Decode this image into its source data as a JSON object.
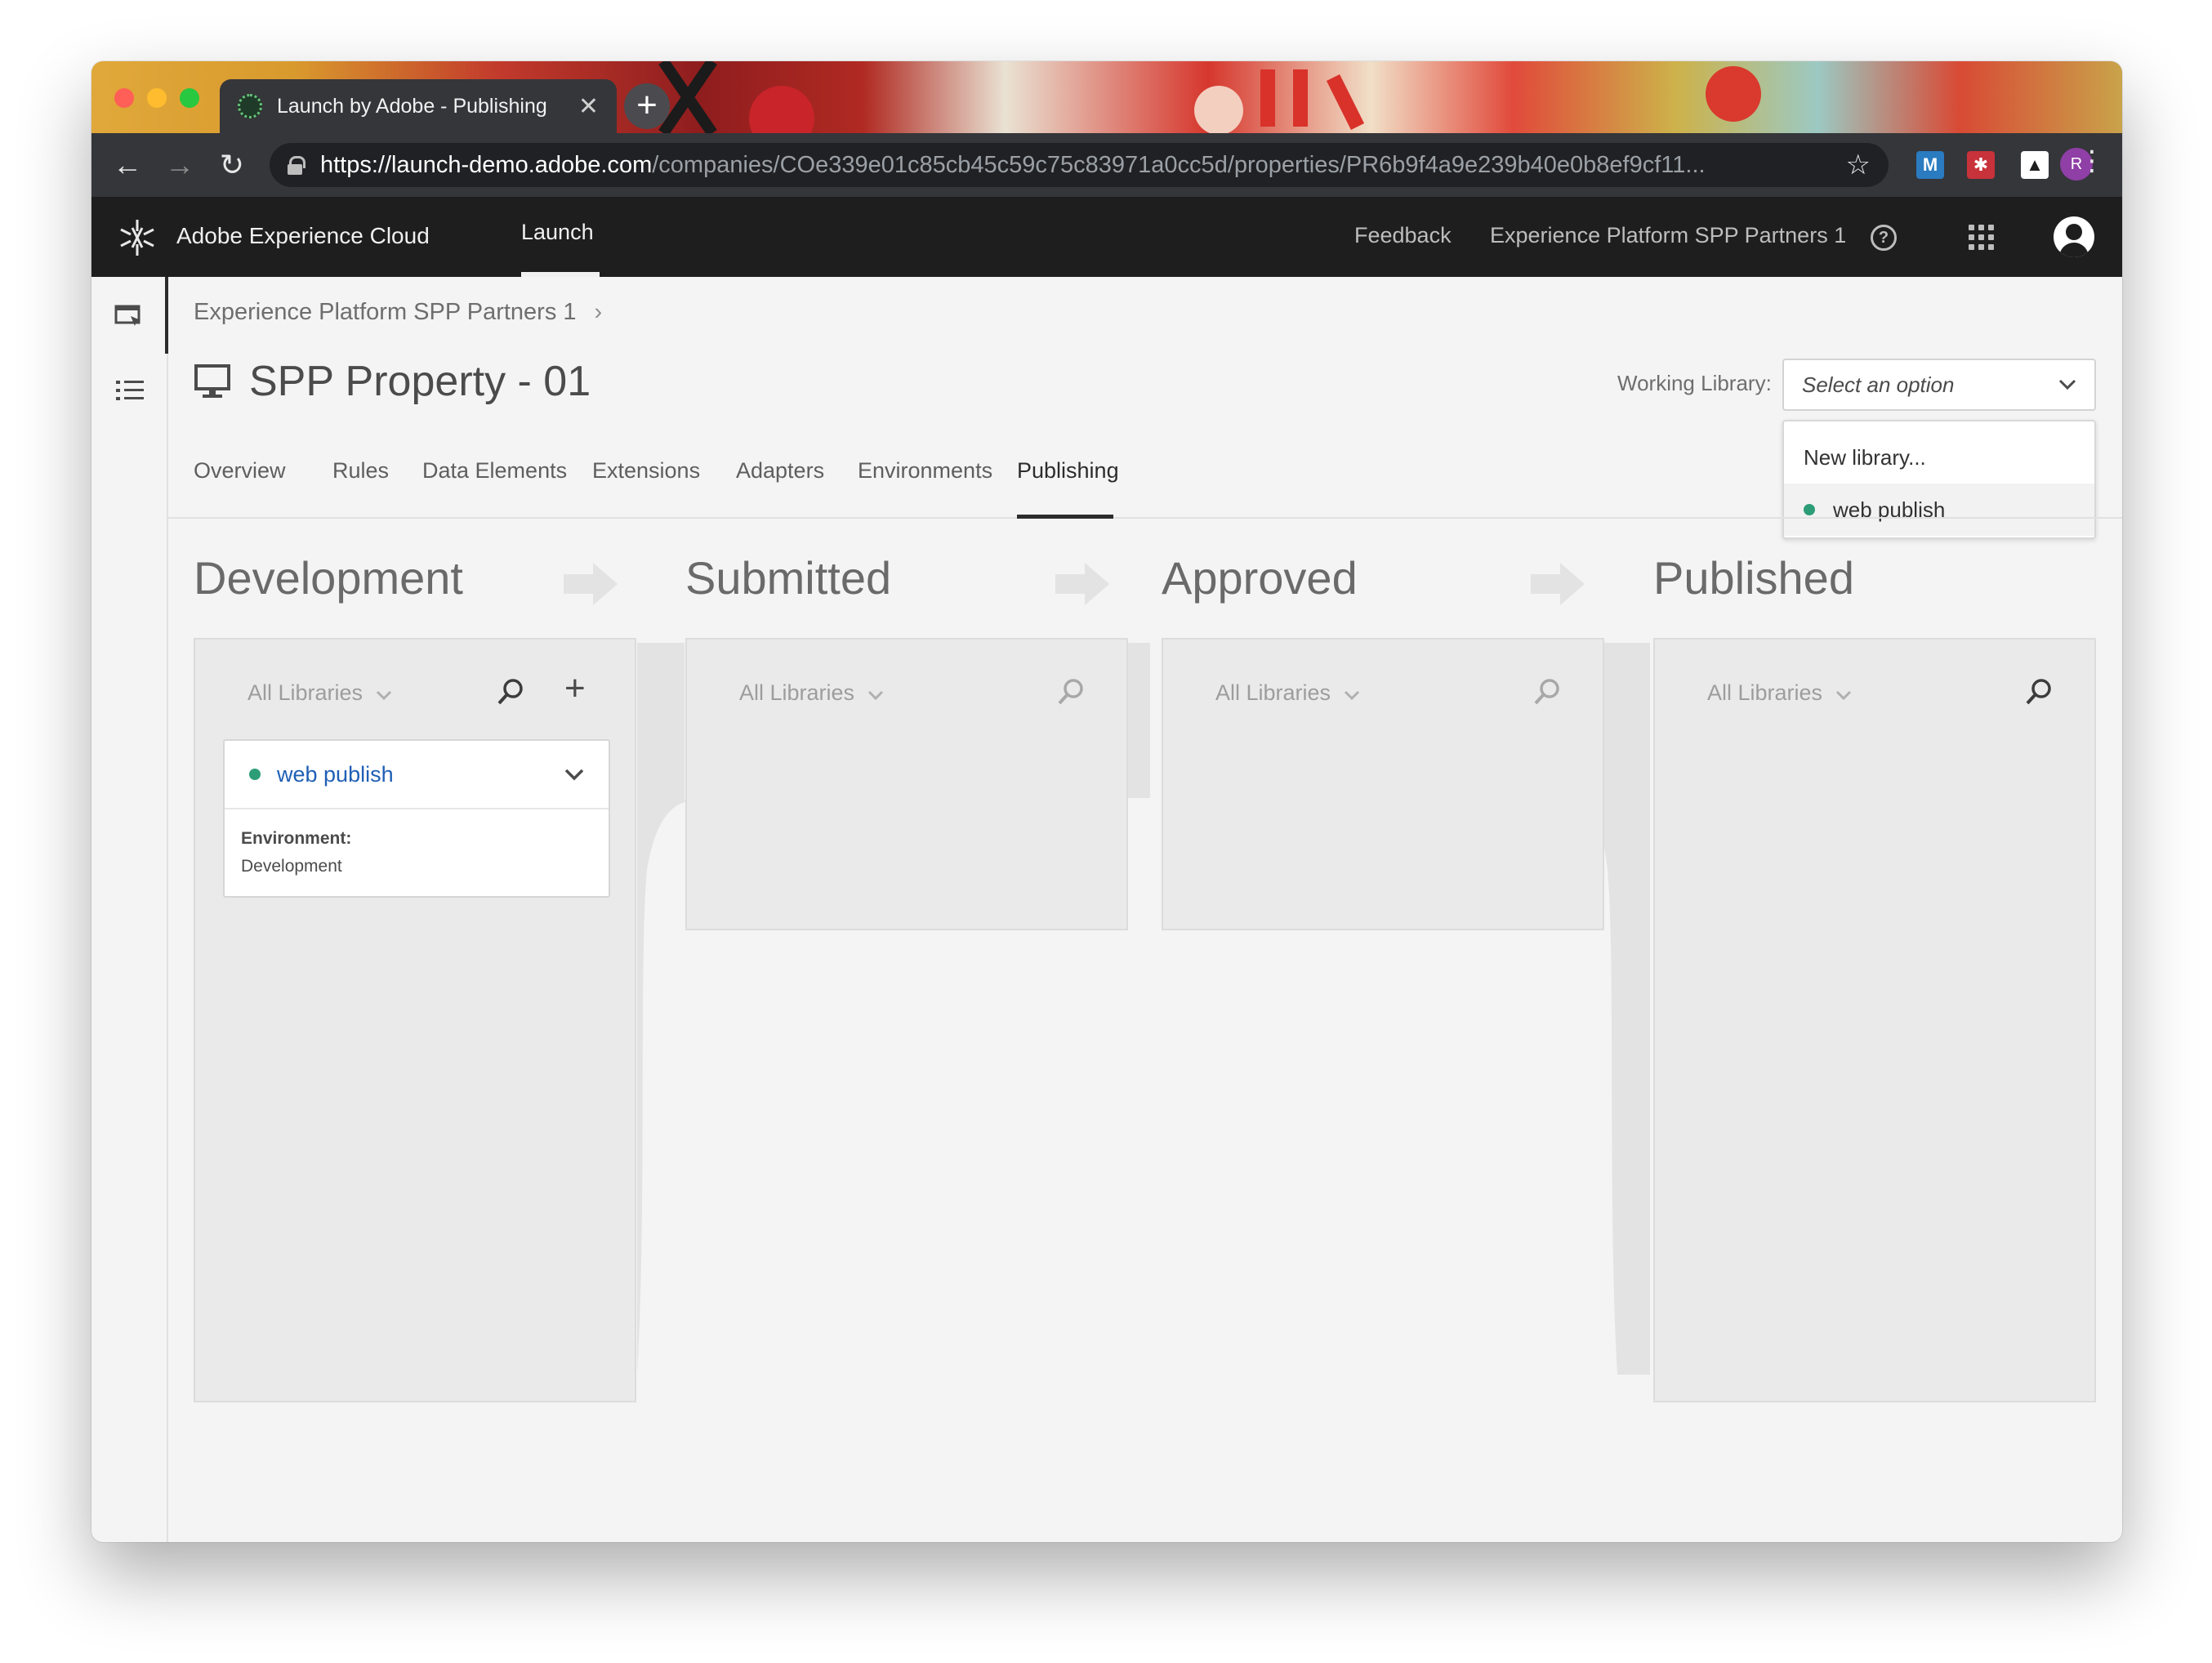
{
  "browser": {
    "tab_title": "Launch by Adobe - Publishing",
    "url_host": "https://launch-demo.adobe.com",
    "url_path": "/companies/COe339e01c85cb45c59c75c83971a0cc5d/properties/PR6b9f4a9e239b40e0b8ef9cf11...",
    "profile_initial": "R",
    "extensions": [
      "M",
      "",
      ""
    ]
  },
  "header": {
    "brand": "Adobe Experience Cloud",
    "product": "Launch",
    "feedback": "Feedback",
    "org": "Experience Platform SPP Partners 1"
  },
  "breadcrumb": {
    "parent": "Experience Platform SPP Partners 1",
    "separator": "›"
  },
  "page": {
    "title": "SPP Property - 01"
  },
  "working_library": {
    "label": "Working Library:",
    "placeholder": "Select an option",
    "options": [
      {
        "label": "New library..."
      },
      {
        "label": "web publish"
      }
    ]
  },
  "tabs": [
    {
      "label": "Overview"
    },
    {
      "label": "Rules"
    },
    {
      "label": "Data Elements"
    },
    {
      "label": "Extensions"
    },
    {
      "label": "Adapters"
    },
    {
      "label": "Environments"
    },
    {
      "label": "Publishing"
    }
  ],
  "active_tab": "Publishing",
  "columns": [
    {
      "title": "Development",
      "filter": "All Libraries"
    },
    {
      "title": "Submitted",
      "filter": "All Libraries"
    },
    {
      "title": "Approved",
      "filter": "All Libraries"
    },
    {
      "title": "Published",
      "filter": "All Libraries"
    }
  ],
  "library_card": {
    "name": "web publish",
    "environment_label": "Environment:",
    "environment_value": "Development"
  },
  "colors": {
    "status_green": "#2d9d78",
    "link_blue": "#1f5fb5",
    "header_bg": "#1e1e1e"
  }
}
